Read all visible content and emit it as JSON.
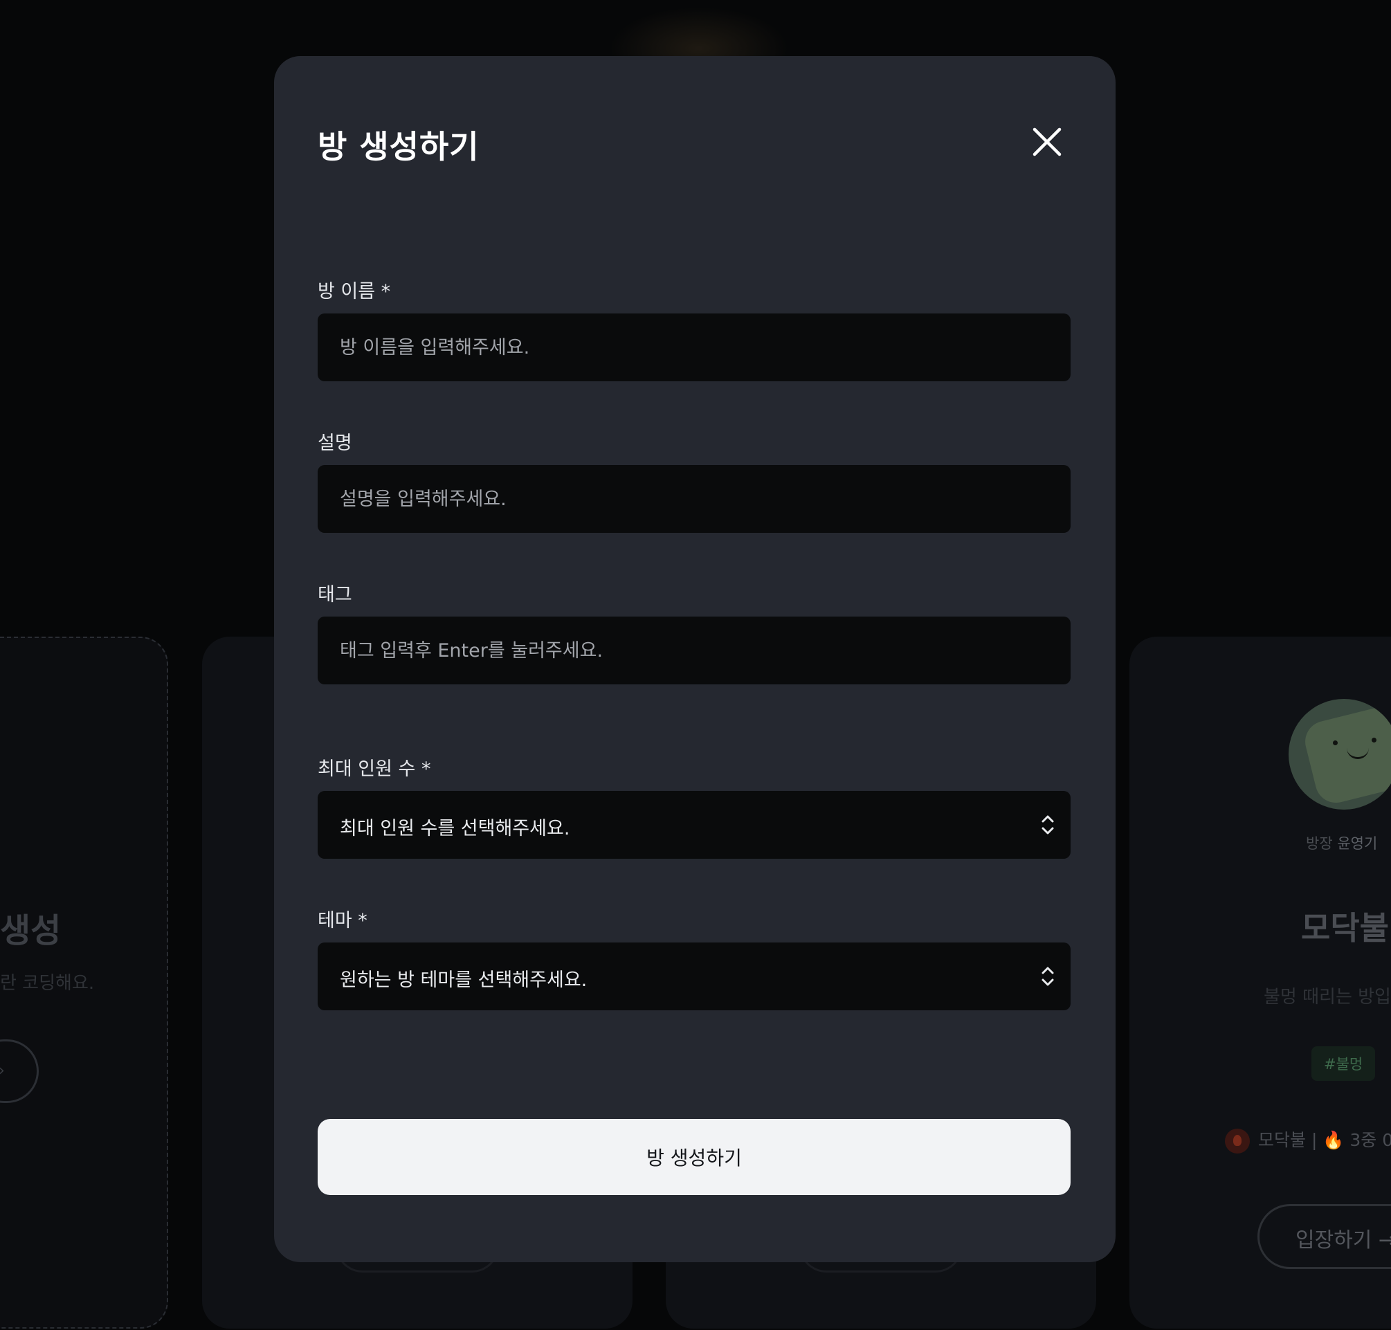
{
  "background": {
    "create_card": {
      "title": "생성",
      "description": "란 코딩해요.",
      "arrow": "›"
    },
    "room_card": {
      "host_prefix": "방장",
      "host_name": "윤영기",
      "title": "모닥불",
      "description": "불멍 때리는 방입",
      "tag": "#불멍",
      "status": "모닥불 | 🔥 3중 0",
      "enter_label": "입장하기 →"
    }
  },
  "modal": {
    "title": "방  생성하기",
    "close_icon": "close-icon",
    "fields": {
      "name": {
        "label": "방 이름 *",
        "placeholder": "방 이름을 입력해주세요."
      },
      "description": {
        "label": "설명",
        "placeholder": "설명을 입력해주세요."
      },
      "tags": {
        "label": "태그",
        "placeholder": "태그 입력후 Enter를 눌러주세요."
      },
      "max_members": {
        "label": "최대 인원 수 *",
        "value": "최대 인원 수를 선택해주세요."
      },
      "theme": {
        "label": "테마 *",
        "value": "원하는 방 테마를 선택해주세요."
      }
    },
    "submit_label": "방 생성하기"
  },
  "colors": {
    "page_background": "#060708",
    "modal_background": "#252830",
    "input_background": "#0a0b0c",
    "submit_background": "#f2f3f5",
    "tag_text": "#3e6b4c"
  }
}
